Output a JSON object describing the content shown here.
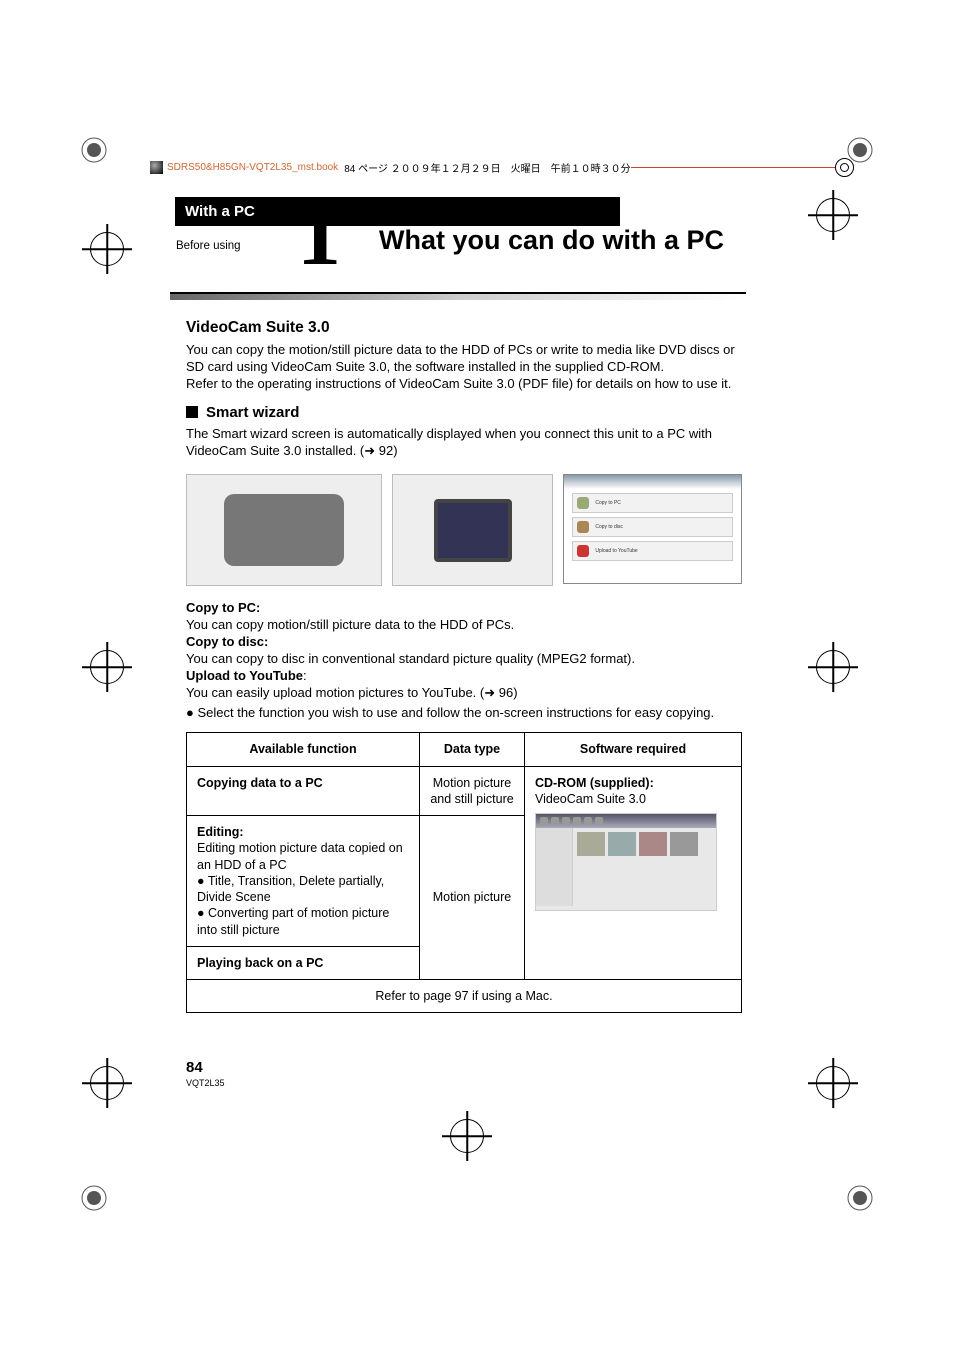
{
  "ruler": {
    "file": "SDRS50&H85GN-VQT2L35_mst.book",
    "info": "84 ページ ２００９年１２月２９日　火曜日　午前１０時３０分"
  },
  "category": "With a PC",
  "subcategory": "Before using",
  "chapter_num": "1",
  "title": "What you can do with a PC",
  "sec1": {
    "heading": "VideoCam Suite 3.0",
    "p1": "You can copy the motion/still picture data to the HDD of PCs or write to media like DVD discs or SD card using VideoCam Suite 3.0, the software installed in the supplied CD-ROM.",
    "p2": "Refer to the operating instructions of VideoCam Suite 3.0 (PDF file) for details on how to use it."
  },
  "smart": {
    "heading": "Smart wizard",
    "p": "The Smart wizard screen is automatically displayed when you connect this unit to a PC with VideoCam Suite 3.0 installed. (",
    "ref": "92)"
  },
  "wizpanel": {
    "r1": "Copy to PC",
    "r2": "Copy to disc",
    "r3": "Upload to YouTube"
  },
  "mid": {
    "h1": "Copy to PC:",
    "t1": "You can copy motion/still picture data to the HDD of PCs.",
    "h2": "Copy to disc:",
    "t2": "You can copy to disc in conventional standard picture quality (MPEG2 format).",
    "h3": "Upload to YouTube",
    "colon": ":",
    "t3": "You can easily upload motion pictures to YouTube. (",
    "t3ref": "96)",
    "bullet": "Select the function you wish to use and follow the on-screen instructions for easy copying."
  },
  "tbl": {
    "hdr": [
      "Available function",
      "Data type",
      "Software required"
    ],
    "r1": {
      "fn": "Copying data to a PC",
      "dt": "Motion picture and still picture",
      "sw1": "CD-ROM (supplied):",
      "sw2": "VideoCam Suite 3.0"
    },
    "r2": {
      "fnH": "Editing:",
      "fn1": "Editing motion picture data copied on an HDD of a PC",
      "fn2": "Title, Transition, Delete partially, Divide Scene",
      "fn3": "Converting part of motion picture into still picture",
      "dt": "Motion picture"
    },
    "r3": {
      "fn": "Playing back on a PC"
    },
    "foot": "Refer to page 97 if using a Mac."
  },
  "footer": {
    "page": "84",
    "code": "VQT2L35"
  }
}
